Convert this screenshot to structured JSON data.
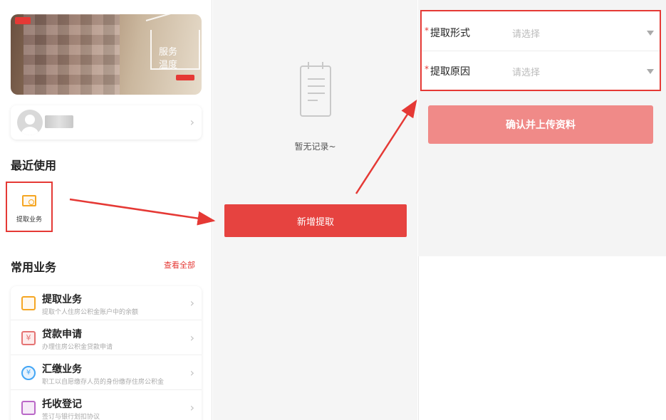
{
  "banner": {
    "brand": "",
    "text_lines": [
      "服务",
      "温度"
    ]
  },
  "user": {
    "name": ""
  },
  "recent": {
    "title": "最近使用",
    "items": [
      {
        "label": "提取业务",
        "icon": "wallet-icon",
        "color": "#f5a623"
      }
    ]
  },
  "common": {
    "title": "常用业务",
    "view_all": "查看全部",
    "items": [
      {
        "title": "提取业务",
        "desc": "提取个人住房公积金账户中的余额",
        "icon": "wallet-icon",
        "color": "#f5a623"
      },
      {
        "title": "贷款申请",
        "desc": "办理住房公积金贷款申请",
        "icon": "loan-icon",
        "color": "#e57373"
      },
      {
        "title": "汇缴业务",
        "desc": "职工以自愿缴存人员的身份缴存住房公积金",
        "icon": "exchange-icon",
        "color": "#42a5f5"
      },
      {
        "title": "托收登记",
        "desc": "签订与银行划扣协议",
        "icon": "form-icon",
        "color": "#ba68c8"
      }
    ]
  },
  "records": {
    "empty_text": "暂无记录~",
    "add_button": "新增提取"
  },
  "form": {
    "fields": [
      {
        "label": "提取形式",
        "placeholder": "请选择",
        "required": "*"
      },
      {
        "label": "提取原因",
        "placeholder": "请选择",
        "required": "*"
      }
    ],
    "confirm_button": "确认并上传资料"
  },
  "colors": {
    "accent": "#e53935",
    "button_red": "#e64340",
    "button_disabled": "#f08a88"
  }
}
